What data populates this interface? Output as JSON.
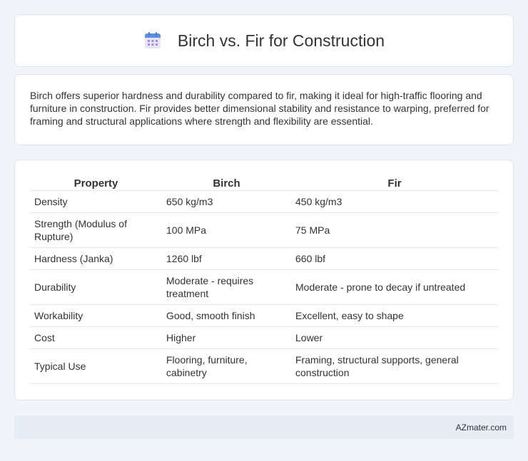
{
  "header": {
    "title": "Birch vs. Fir for Construction",
    "icon": "calendar-icon",
    "icon_colors": {
      "top": "#5b8fe0",
      "body": "#e8e4f7",
      "dots": "#a78bdc"
    }
  },
  "summary": {
    "text": "Birch offers superior hardness and durability compared to fir, making it ideal for high-traffic flooring and furniture in construction. Fir provides better dimensional stability and resistance to warping, preferred for framing and structural applications where strength and flexibility are essential."
  },
  "table": {
    "headers": [
      "Property",
      "Birch",
      "Fir"
    ],
    "rows": [
      [
        "Density",
        "650 kg/m3",
        "450 kg/m3"
      ],
      [
        "Strength (Modulus of Rupture)",
        "100 MPa",
        "75 MPa"
      ],
      [
        "Hardness (Janka)",
        "1260 lbf",
        "660 lbf"
      ],
      [
        "Durability",
        "Moderate - requires treatment",
        "Moderate - prone to decay if untreated"
      ],
      [
        "Workability",
        "Good, smooth finish",
        "Excellent, easy to shape"
      ],
      [
        "Cost",
        "Higher",
        "Lower"
      ],
      [
        "Typical Use",
        "Flooring, furniture, cabinetry",
        "Framing, structural supports, general construction"
      ]
    ]
  },
  "footer": {
    "site": "AZmater.com"
  }
}
